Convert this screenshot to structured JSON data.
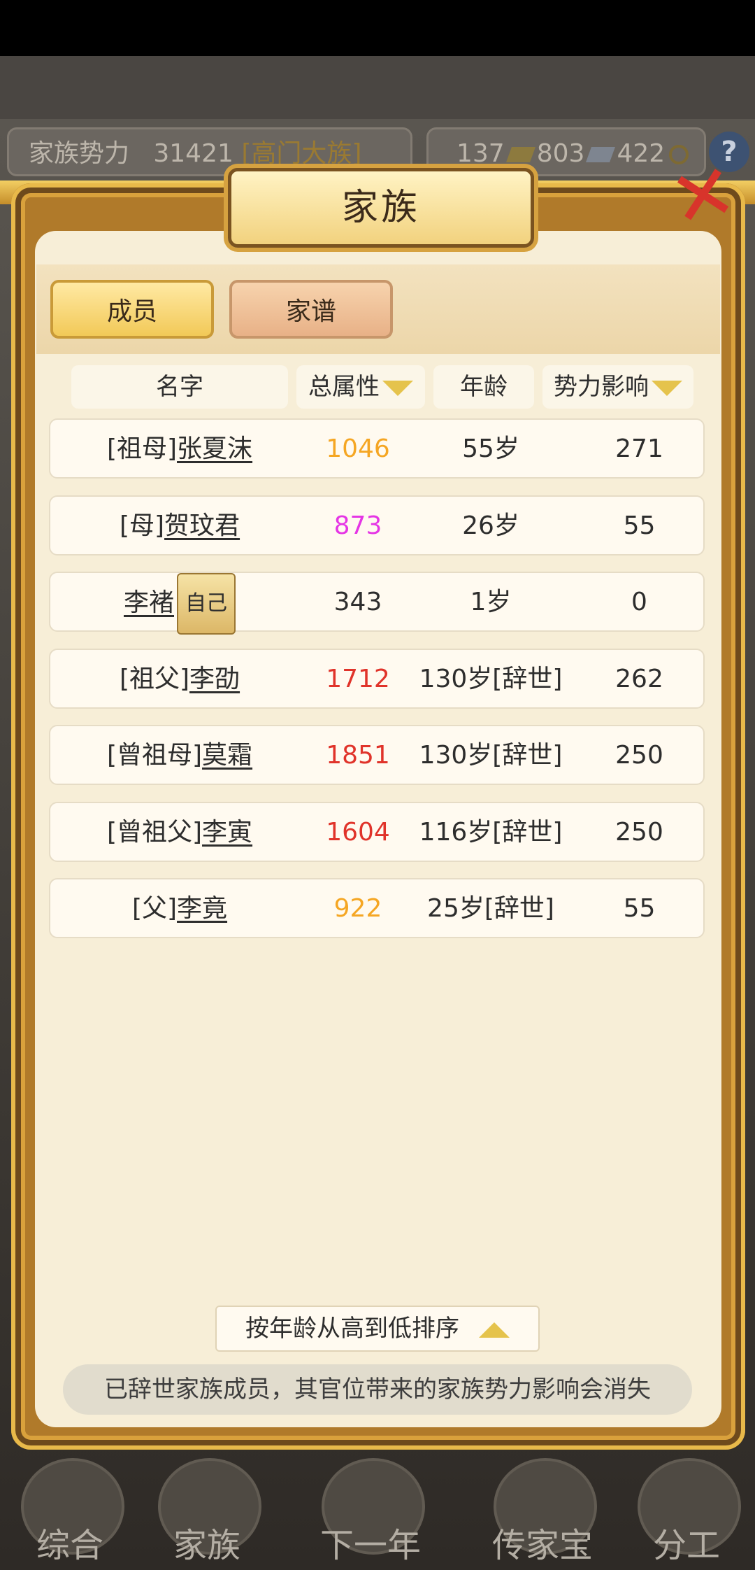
{
  "topbar": {
    "power_label": "家族势力",
    "power_value": "31421",
    "power_level": "[高门大族]",
    "gold": "137",
    "silver": "803",
    "coins": "422",
    "help_label": "?"
  },
  "panel": {
    "title": "家族",
    "close_label": "✕"
  },
  "tabs": [
    {
      "label": "成员",
      "active": true
    },
    {
      "label": "家谱",
      "active": false
    }
  ],
  "headers": {
    "name": "名字",
    "attr": "总属性",
    "age": "年龄",
    "influence": "势力影响"
  },
  "colors": {
    "orange": "#f5a623",
    "magenta": "#e535e5",
    "red": "#e0332a",
    "default": "#2d2d2d"
  },
  "members": [
    {
      "relation": "[祖母]",
      "name": "张夏沫",
      "self": "",
      "attr": "1046",
      "attr_color": "orange",
      "age": "55岁",
      "influence": "271"
    },
    {
      "relation": "[母]",
      "name": "贺玟君",
      "self": "",
      "attr": "873",
      "attr_color": "magenta",
      "age": "26岁",
      "influence": "55"
    },
    {
      "relation": "",
      "name": "李褚",
      "self": "自己",
      "attr": "343",
      "attr_color": "default",
      "age": "1岁",
      "influence": "0"
    },
    {
      "relation": "[祖父]",
      "name": "李劭",
      "self": "",
      "attr": "1712",
      "attr_color": "red",
      "age": "130岁[辞世]",
      "influence": "262"
    },
    {
      "relation": "[曾祖母]",
      "name": "莫霜",
      "self": "",
      "attr": "1851",
      "attr_color": "red",
      "age": "130岁[辞世]",
      "influence": "250"
    },
    {
      "relation": "[曾祖父]",
      "name": "李寅",
      "self": "",
      "attr": "1604",
      "attr_color": "red",
      "age": "116岁[辞世]",
      "influence": "250"
    },
    {
      "relation": "[父]",
      "name": "李竟",
      "self": "",
      "attr": "922",
      "attr_color": "orange",
      "age": "25岁[辞世]",
      "influence": "55"
    }
  ],
  "sort": {
    "label": "按年龄从高到低排序"
  },
  "notice": "已辞世家族成员，其官位带来的家族势力影响会消失",
  "bottom_nav": [
    {
      "label": "综合"
    },
    {
      "label": "家族"
    },
    {
      "label": "下一年"
    },
    {
      "label": "传家宝"
    },
    {
      "label": "分工"
    }
  ]
}
